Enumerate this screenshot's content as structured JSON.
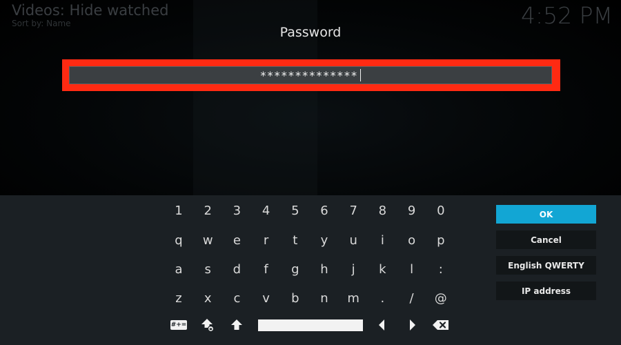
{
  "background": {
    "view_title": "Videos: Hide watched",
    "sort_label": "Sort by: Name",
    "clock": "4:52 PM"
  },
  "dialog": {
    "heading": "Password",
    "input_value": "**************",
    "highlight_color": "#ff2a12"
  },
  "keyboard": {
    "rows": [
      [
        "1",
        "2",
        "3",
        "4",
        "5",
        "6",
        "7",
        "8",
        "9",
        "0"
      ],
      [
        "q",
        "w",
        "e",
        "r",
        "t",
        "y",
        "u",
        "i",
        "o",
        "p"
      ],
      [
        "a",
        "s",
        "d",
        "f",
        "g",
        "h",
        "j",
        "k",
        "l",
        ":"
      ],
      [
        "z",
        "x",
        "c",
        "v",
        "b",
        "n",
        "m",
        ".",
        "/",
        "@"
      ]
    ],
    "symbols_label": "#+=",
    "function_icons": [
      "symbols-toggle-icon",
      "caps-lock-icon",
      "shift-icon",
      "space-bar",
      "cursor-left-icon",
      "cursor-right-icon",
      "backspace-icon"
    ]
  },
  "buttons": {
    "ok": "OK",
    "cancel": "Cancel",
    "layout": "English QWERTY",
    "ip_address": "IP address",
    "accent": "#12a6d4"
  }
}
